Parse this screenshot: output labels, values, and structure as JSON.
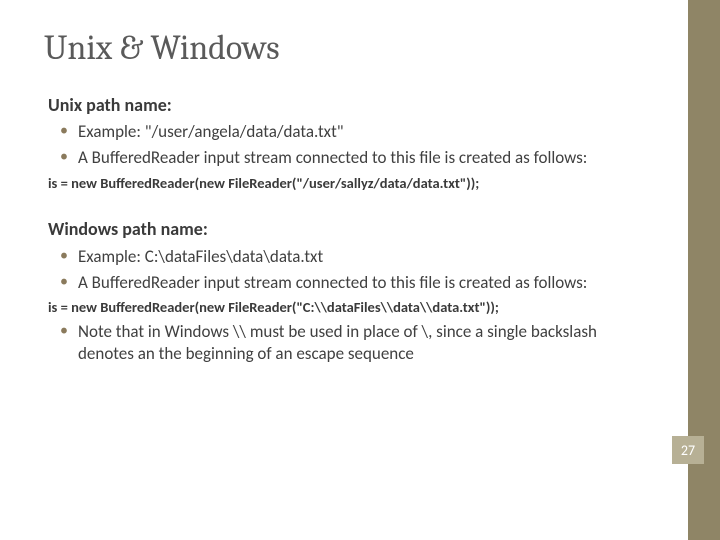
{
  "title": "Unix & Windows",
  "unix": {
    "heading": "Unix path name:",
    "bullet1": "Example: \"/user/angela/data/data.txt\"",
    "bullet2": "A BufferedReader input stream connected to this file is created as follows:",
    "code": "is = new BufferedReader(new FileReader(\"/user/sallyz/data/data.txt\"));"
  },
  "windows": {
    "heading": "Windows path name:",
    "bullet1": "Example: C:\\dataFiles\\data\\data.txt",
    "bullet2": "A BufferedReader input stream connected to this file is created as follows:",
    "code": "is = new BufferedReader(new FileReader(\"C:\\\\dataFiles\\\\data\\\\data.txt\"));",
    "bullet3": "Note that in Windows \\\\ must be used in place of \\, since a single backslash denotes an the beginning of an escape sequence"
  },
  "pageNumber": "27"
}
